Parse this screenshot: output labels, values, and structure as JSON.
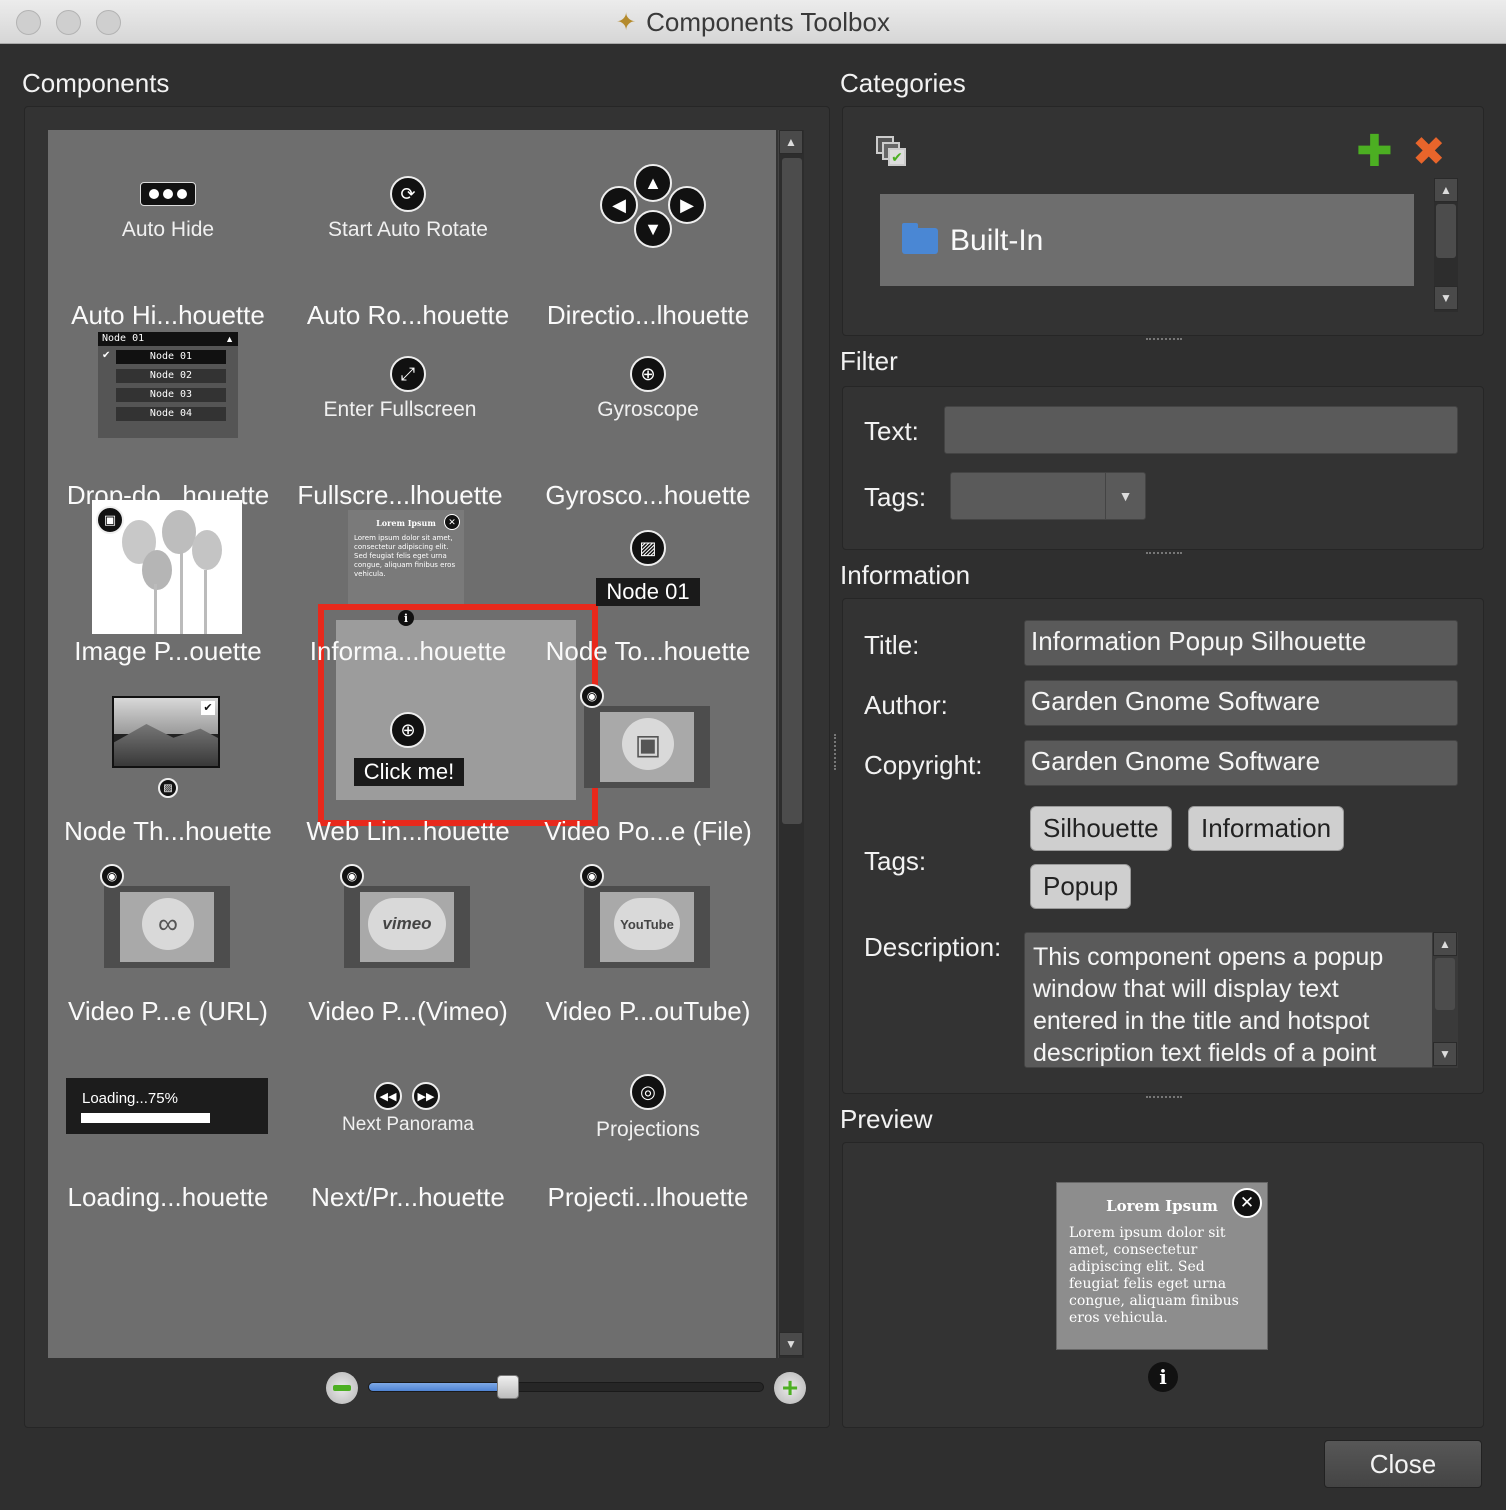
{
  "window": {
    "title": "Components Toolbox"
  },
  "components": {
    "heading": "Components",
    "items": [
      {
        "name": "Auto Hi...houette",
        "preview_label": "Auto Hide",
        "icon": "ellipsis-icon"
      },
      {
        "name": "Auto Ro...houette",
        "preview_label": "Start Auto Rotate",
        "icon": "rotate-icon"
      },
      {
        "name": "Directio...lhouette",
        "preview_label": "",
        "icon": "arrows-icon"
      },
      {
        "name": "Drop-do...houette",
        "preview_label": "",
        "icon": "dropdown-icon",
        "dropdown": {
          "header": "Node 01",
          "options": [
            "Node 01",
            "Node 02",
            "Node 03",
            "Node 04"
          ]
        }
      },
      {
        "name": "Fullscre...lhouette",
        "preview_label": "Enter Fullscreen",
        "icon": "fullscreen-icon"
      },
      {
        "name": "Gyrosco...houette",
        "preview_label": "Gyroscope",
        "icon": "gyroscope-icon"
      },
      {
        "name": "Image P...ouette",
        "preview_label": "",
        "icon": "image-icon"
      },
      {
        "name": "Informa...houette",
        "preview_label": "",
        "icon": "info-icon",
        "selected": true
      },
      {
        "name": "Node To...houette",
        "preview_label": "Node 01",
        "icon": "picture-icon"
      },
      {
        "name": "Node Th...houette",
        "preview_label": "",
        "icon": "thumbnail-icon"
      },
      {
        "name": "Web Lin...houette",
        "preview_label": "Click me!",
        "icon": "globe-icon"
      },
      {
        "name": "Video Po...e (File)",
        "preview_label": "",
        "icon": "floppy-icon"
      },
      {
        "name": "Video P...e (URL)",
        "preview_label": "",
        "icon": "link-icon"
      },
      {
        "name": "Video P...(Vimeo)",
        "preview_label": "vimeo",
        "icon": "vimeo-icon"
      },
      {
        "name": "Video P...ouTube)",
        "preview_label": "YouTube",
        "icon": "youtube-icon"
      },
      {
        "name": "Loading...houette",
        "preview_label": "Loading...75%",
        "icon": "progress-icon",
        "progress": 0.75
      },
      {
        "name": "Next/Pr...houette",
        "preview_label": "Next Panorama",
        "icon": "prev-next-icon"
      },
      {
        "name": "Projecti...lhouette",
        "preview_label": "Projections",
        "icon": "projection-icon"
      }
    ],
    "zoom_level": 0.35
  },
  "categories": {
    "heading": "Categories",
    "items": [
      {
        "label": "Built-In",
        "icon": "folder-icon"
      }
    ]
  },
  "filter": {
    "heading": "Filter",
    "text_label": "Text:",
    "text_value": "",
    "tags_label": "Tags:",
    "tags_value": ""
  },
  "information": {
    "heading": "Information",
    "title_label": "Title:",
    "title_value": "Information Popup Silhouette",
    "author_label": "Author:",
    "author_value": "Garden Gnome Software",
    "copyright_label": "Copyright:",
    "copyright_value": "Garden Gnome Software",
    "tags_label": "Tags:",
    "tags": [
      "Silhouette",
      "Information",
      "Popup"
    ],
    "description_label": "Description:",
    "description_value": "This component opens a popup window that will display text entered in the title and hotspot description text fields of a point"
  },
  "preview": {
    "heading": "Preview",
    "popup_title": "Lorem Ipsum",
    "popup_text": "Lorem ipsum dolor sit amet, consectetur adipiscing elit. Sed feugiat felis eget urna congue, aliquam finibus eros vehicula."
  },
  "buttons": {
    "close": "Close"
  },
  "colors": {
    "selection": "#e8291c",
    "add": "#4caf22",
    "remove": "#e8652b"
  }
}
